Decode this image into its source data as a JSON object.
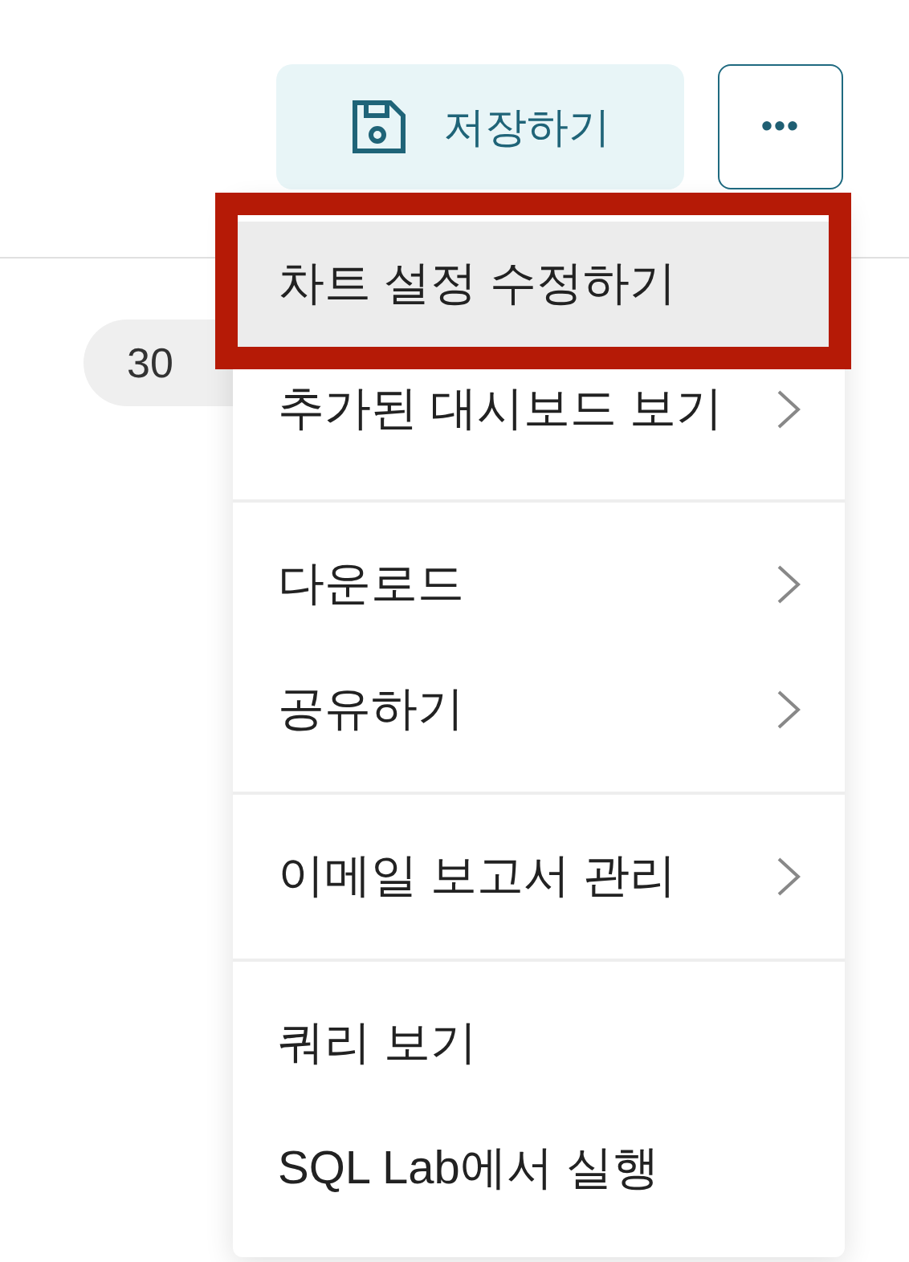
{
  "toolbar": {
    "save_button": "저장하기",
    "more_button": "•••"
  },
  "chip": {
    "label": "30"
  },
  "menu": {
    "groups": [
      {
        "items": [
          {
            "label": "차트 설정 수정하기",
            "submenu": false,
            "selected": true,
            "annotated": true
          },
          {
            "label": "추가된 대시보드 보기",
            "submenu": true,
            "selected": false,
            "annotated": false
          }
        ]
      },
      {
        "items": [
          {
            "label": "다운로드",
            "submenu": true,
            "selected": false,
            "annotated": false
          },
          {
            "label": "공유하기",
            "submenu": true,
            "selected": false,
            "annotated": false
          }
        ]
      },
      {
        "items": [
          {
            "label": "이메일 보고서 관리",
            "submenu": true,
            "selected": false,
            "annotated": false
          }
        ]
      },
      {
        "items": [
          {
            "label": "쿼리 보기",
            "submenu": false,
            "selected": false,
            "annotated": false
          },
          {
            "label": "SQL Lab에서 실행",
            "submenu": false,
            "selected": false,
            "annotated": false
          }
        ]
      }
    ]
  }
}
